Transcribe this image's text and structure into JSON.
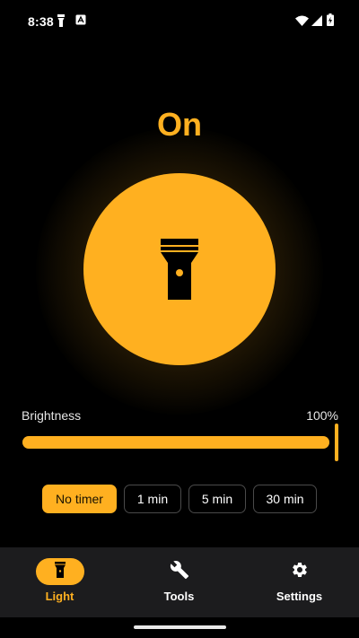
{
  "status_bar": {
    "time": "8:38",
    "icons": [
      "flashlight-status-icon",
      "keyboard-status-icon",
      "wifi-icon",
      "cellular-signal-icon",
      "battery-charging-icon"
    ]
  },
  "power": {
    "state_label": "On",
    "is_on": true,
    "icon": "flashlight-icon"
  },
  "brightness": {
    "label": "Brightness",
    "value_text": "100%",
    "level": 1.0
  },
  "timer": {
    "options": [
      {
        "label": "No timer",
        "selected": true
      },
      {
        "label": "1 min",
        "selected": false
      },
      {
        "label": "5 min",
        "selected": false
      },
      {
        "label": "30 min",
        "selected": false
      }
    ]
  },
  "nav": {
    "items": [
      {
        "label": "Light",
        "icon": "flashlight-icon",
        "active": true
      },
      {
        "label": "Tools",
        "icon": "wrench-icon",
        "active": false
      },
      {
        "label": "Settings",
        "icon": "gear-icon",
        "active": false
      }
    ]
  },
  "colors": {
    "accent": "#FFB020",
    "background": "#000000",
    "nav_background": "#1C1C1E",
    "chip_border": "#4A4A4A"
  }
}
